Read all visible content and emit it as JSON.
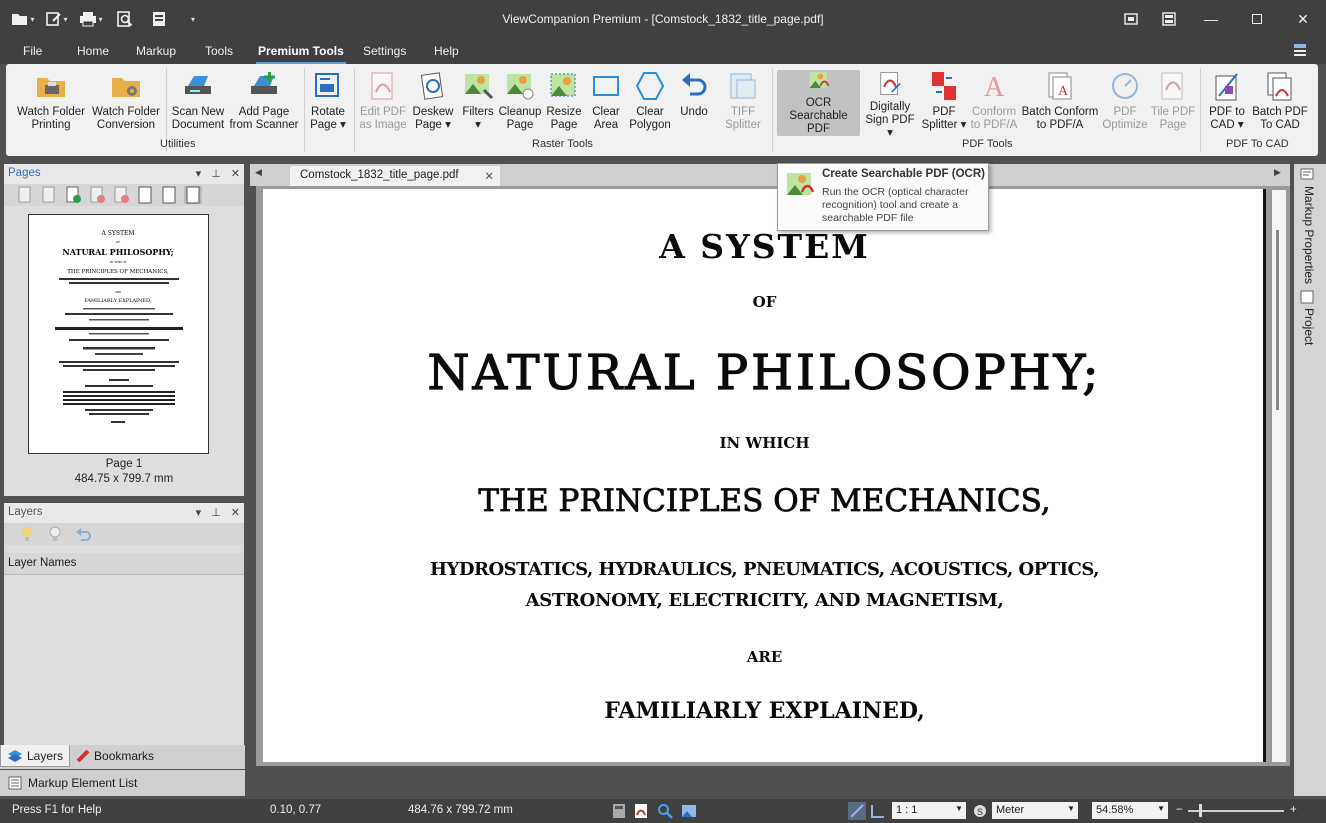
{
  "window": {
    "title": "ViewCompanion Premium - [Comstock_1832_title_page.pdf]",
    "controls": [
      "restore-to-tile",
      "tile-windows",
      "minimize",
      "maximize",
      "close"
    ]
  },
  "menu_tabs": [
    {
      "label": "File",
      "active": false
    },
    {
      "label": "Home",
      "active": false
    },
    {
      "label": "Markup",
      "active": false
    },
    {
      "label": "Tools",
      "active": false
    },
    {
      "label": "Premium Tools",
      "active": true
    },
    {
      "label": "Settings",
      "active": false
    },
    {
      "label": "Help",
      "active": false
    }
  ],
  "ribbon": {
    "utilities": {
      "label": "Utilities",
      "buttons": [
        {
          "line1": "Watch Folder",
          "line2": "Printing",
          "icon": "folder-printer-icon"
        },
        {
          "line1": "Watch Folder",
          "line2": "Conversion",
          "icon": "folder-gear-icon"
        },
        {
          "line1": "Scan New",
          "line2": "Document",
          "icon": "scanner-icon"
        },
        {
          "line1": "Add Page",
          "line2": "from Scanner",
          "icon": "scanner-add-icon"
        },
        {
          "line1": "Rotate",
          "line2": "Page ▾",
          "icon": "rotate-page-icon"
        }
      ]
    },
    "raster_tools": {
      "label": "Raster Tools",
      "buttons": [
        {
          "line1": "Edit PDF",
          "line2": "as Image",
          "icon": "edit-pdf-icon",
          "disabled": true
        },
        {
          "line1": "Deskew",
          "line2": "Page ▾",
          "icon": "deskew-icon"
        },
        {
          "line1": "Filters",
          "line2": "▾",
          "icon": "filters-icon"
        },
        {
          "line1": "Cleanup",
          "line2": "Page",
          "icon": "cleanup-icon"
        },
        {
          "line1": "Resize",
          "line2": "Page",
          "icon": "resize-icon"
        },
        {
          "line1": "Clear",
          "line2": "Area",
          "icon": "clear-area-icon"
        },
        {
          "line1": "Clear",
          "line2": "Polygon",
          "icon": "clear-polygon-icon"
        },
        {
          "line1": "Undo",
          "line2": "",
          "icon": "undo-icon"
        },
        {
          "line1": "TIFF",
          "line2": "Splitter",
          "icon": "tiff-splitter-icon",
          "disabled": true
        }
      ]
    },
    "pdf_tools": {
      "label": "PDF Tools",
      "buttons": [
        {
          "line1": "OCR",
          "line2": "Searchable PDF",
          "icon": "ocr-icon",
          "selected": true
        },
        {
          "line1": "Digitally",
          "line2": "Sign PDF ▾",
          "icon": "sign-pdf-icon"
        },
        {
          "line1": "PDF",
          "line2": "Splitter ▾",
          "icon": "pdf-splitter-icon"
        },
        {
          "line1": "Conform",
          "line2": "to PDF/A",
          "icon": "conform-pdfa-icon",
          "disabled": true
        },
        {
          "line1": "Batch Conform",
          "line2": "to PDF/A",
          "icon": "batch-conform-icon"
        },
        {
          "line1": "PDF",
          "line2": "Optimize",
          "icon": "pdf-optimize-icon",
          "disabled": true
        },
        {
          "line1": "Tile PDF",
          "line2": "Page",
          "icon": "tile-pdf-icon",
          "disabled": true
        }
      ]
    },
    "pdf_to_cad": {
      "label": "PDF To CAD",
      "buttons": [
        {
          "line1": "PDF to",
          "line2": "CAD ▾",
          "icon": "pdf-to-cad-icon"
        },
        {
          "line1": "Batch PDF",
          "line2": "To CAD",
          "icon": "batch-pdf-cad-icon"
        }
      ]
    }
  },
  "tooltip": {
    "title": "Create Searchable PDF (OCR)",
    "body": "Run the OCR (optical character recognition) tool and create a searchable PDF file"
  },
  "pages_panel": {
    "title": "Pages",
    "page_label": "Page 1",
    "page_size": "484.75 x 799.7 mm"
  },
  "layers_panel": {
    "title": "Layers",
    "column": "Layer Names"
  },
  "bottom_tabs": [
    {
      "label": "Layers",
      "active": true
    },
    {
      "label": "Bookmarks",
      "active": false
    }
  ],
  "markup_list": "Markup Element List",
  "doc_tab": "Comstock_1832_title_page.pdf",
  "document": {
    "lines": [
      "A SYSTEM",
      "OF",
      "NATURAL PHILOSOPHY;",
      "IN WHICH",
      "THE PRINCIPLES OF MECHANICS,",
      "HYDROSTATICS, HYDRAULICS, PNEUMATICS, ACOUSTICS, OPTICS,",
      "ASTRONOMY, ELECTRICITY, AND MAGNETISM,",
      "ARE",
      "FAMILIARLY EXPLAINED,"
    ]
  },
  "thumbnail": {
    "lines": [
      "A SYSTEM",
      "OF",
      "NATURAL PHILOSOPHY;",
      "IN WHICH",
      "THE PRINCIPLES OF MECHANICS,",
      "ARE",
      "FAMILIARLY EXPLAINED;"
    ]
  },
  "right_dock": {
    "markup_properties": "Markup Properties",
    "project": "Project"
  },
  "status": {
    "help": "Press F1 for Help",
    "coords": "0.10, 0.77",
    "size": "484.76 x 799.72 mm",
    "scale": "1 : 1",
    "unit": "Meter",
    "zoom": "54.58%"
  }
}
